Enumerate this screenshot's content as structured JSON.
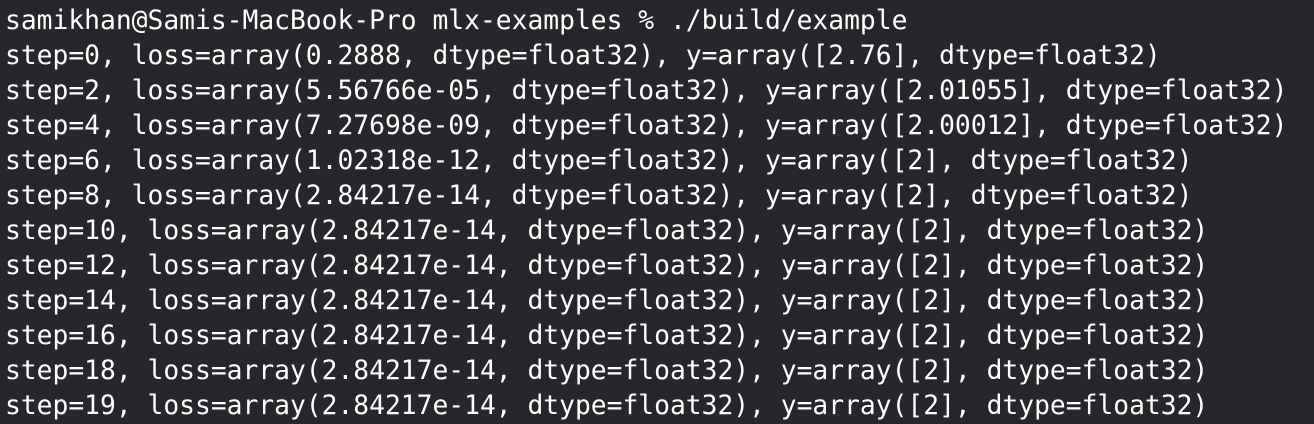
{
  "terminal": {
    "prompt": "samikhan@Samis-MacBook-Pro mlx-examples % ./build/example",
    "lines": [
      "step=0, loss=array(0.2888, dtype=float32), y=array([2.76], dtype=float32)",
      "step=2, loss=array(5.56766e-05, dtype=float32), y=array([2.01055], dtype=float32)",
      "step=4, loss=array(7.27698e-09, dtype=float32), y=array([2.00012], dtype=float32)",
      "step=6, loss=array(1.02318e-12, dtype=float32), y=array([2], dtype=float32)",
      "step=8, loss=array(2.84217e-14, dtype=float32), y=array([2], dtype=float32)",
      "step=10, loss=array(2.84217e-14, dtype=float32), y=array([2], dtype=float32)",
      "step=12, loss=array(2.84217e-14, dtype=float32), y=array([2], dtype=float32)",
      "step=14, loss=array(2.84217e-14, dtype=float32), y=array([2], dtype=float32)",
      "step=16, loss=array(2.84217e-14, dtype=float32), y=array([2], dtype=float32)",
      "step=18, loss=array(2.84217e-14, dtype=float32), y=array([2], dtype=float32)",
      "step=19, loss=array(2.84217e-14, dtype=float32), y=array([2], dtype=float32)"
    ]
  },
  "colors": {
    "background": "#26272b",
    "text": "#ffffff"
  }
}
